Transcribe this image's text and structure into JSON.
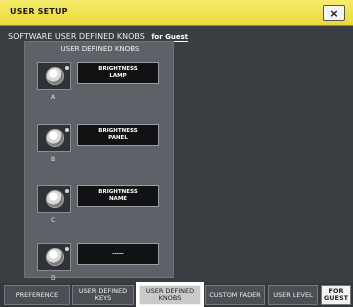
{
  "window": {
    "title": "USER SETUP",
    "close_label": "×"
  },
  "header": {
    "text": "SOFTWARE USER DEFINED KNOBS",
    "user_tag": "for Guest"
  },
  "panel": {
    "title": "USER DEFINED KNOBS",
    "knobs": [
      {
        "letter": "A",
        "line1": "BRIGHTNESS",
        "line2": "LAMP"
      },
      {
        "letter": "B",
        "line1": "BRIGHTNESS",
        "line2": "PANEL"
      },
      {
        "letter": "C",
        "line1": "BRIGHTNESS",
        "line2": "NAME"
      },
      {
        "letter": "D",
        "line1": "-----",
        "line2": ""
      }
    ]
  },
  "tabs": [
    {
      "line1": "PREFERENCE",
      "line2": ""
    },
    {
      "line1": "USER DEFINED",
      "line2": "KEYS"
    },
    {
      "line1": "USER DEFINED",
      "line2": "KNOBS"
    },
    {
      "line1": "CUSTOM FADER",
      "line2": ""
    },
    {
      "line1": "USER LEVEL",
      "line2": ""
    },
    {
      "line1": "FOR",
      "line2": "GUEST"
    }
  ]
}
